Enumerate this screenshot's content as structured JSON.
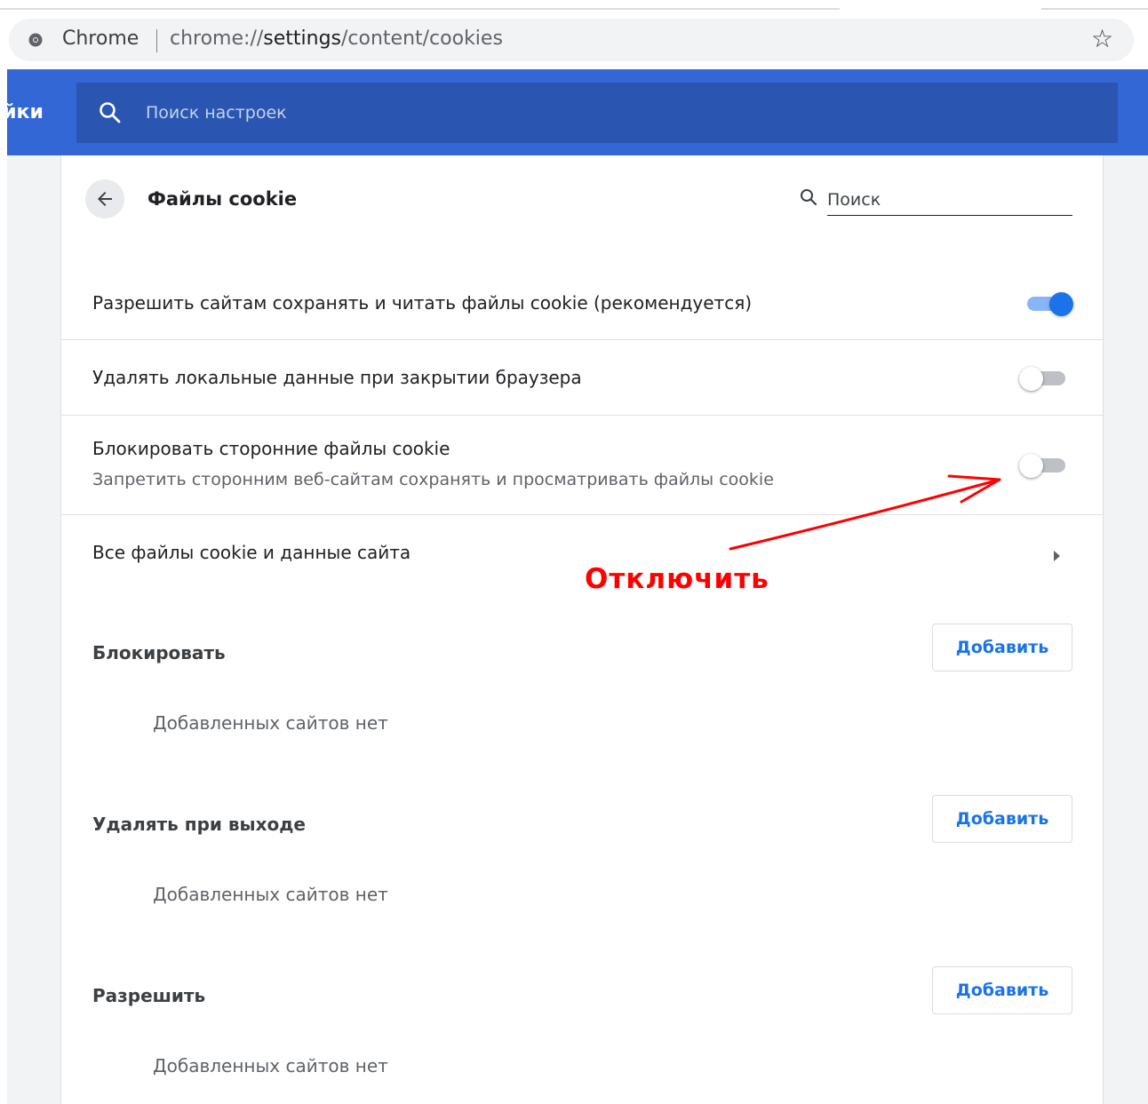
{
  "browser": {
    "site_name": "Chrome",
    "url_prefix": "chrome://",
    "url_host": "settings",
    "url_path": "/content/cookies",
    "icons": {
      "site": "chrome-info-icon",
      "bookmark": "star-icon"
    }
  },
  "header": {
    "title_fragment": "ойки",
    "search_placeholder": "Поиск настроек"
  },
  "page": {
    "title": "Файлы cookie",
    "search_placeholder": "Поиск"
  },
  "settings": [
    {
      "label": "Разрешить сайтам сохранять и читать файлы cookie (рекомендуется)",
      "enabled": true
    },
    {
      "label": "Удалять локальные данные при закрытии браузера",
      "enabled": false
    },
    {
      "label": "Блокировать сторонние файлы cookie",
      "sublabel": "Запретить сторонним веб-сайтам сохранять и просматривать файлы cookie",
      "enabled": false
    }
  ],
  "all_cookies_link": "Все файлы cookie и данные сайта",
  "sections": [
    {
      "title": "Блокировать",
      "button": "Добавить",
      "empty": "Добавленных сайтов нет"
    },
    {
      "title": "Удалять при выходе",
      "button": "Добавить",
      "empty": "Добавленных сайтов нет"
    },
    {
      "title": "Разрешить",
      "button": "Добавить",
      "empty": "Добавленных сайтов нет"
    }
  ],
  "annotation": {
    "text": "Отключить",
    "color": "#ff0000"
  },
  "colors": {
    "accent": "#1a73e8",
    "header": "#3367d6",
    "header_search": "#2a56b2"
  }
}
